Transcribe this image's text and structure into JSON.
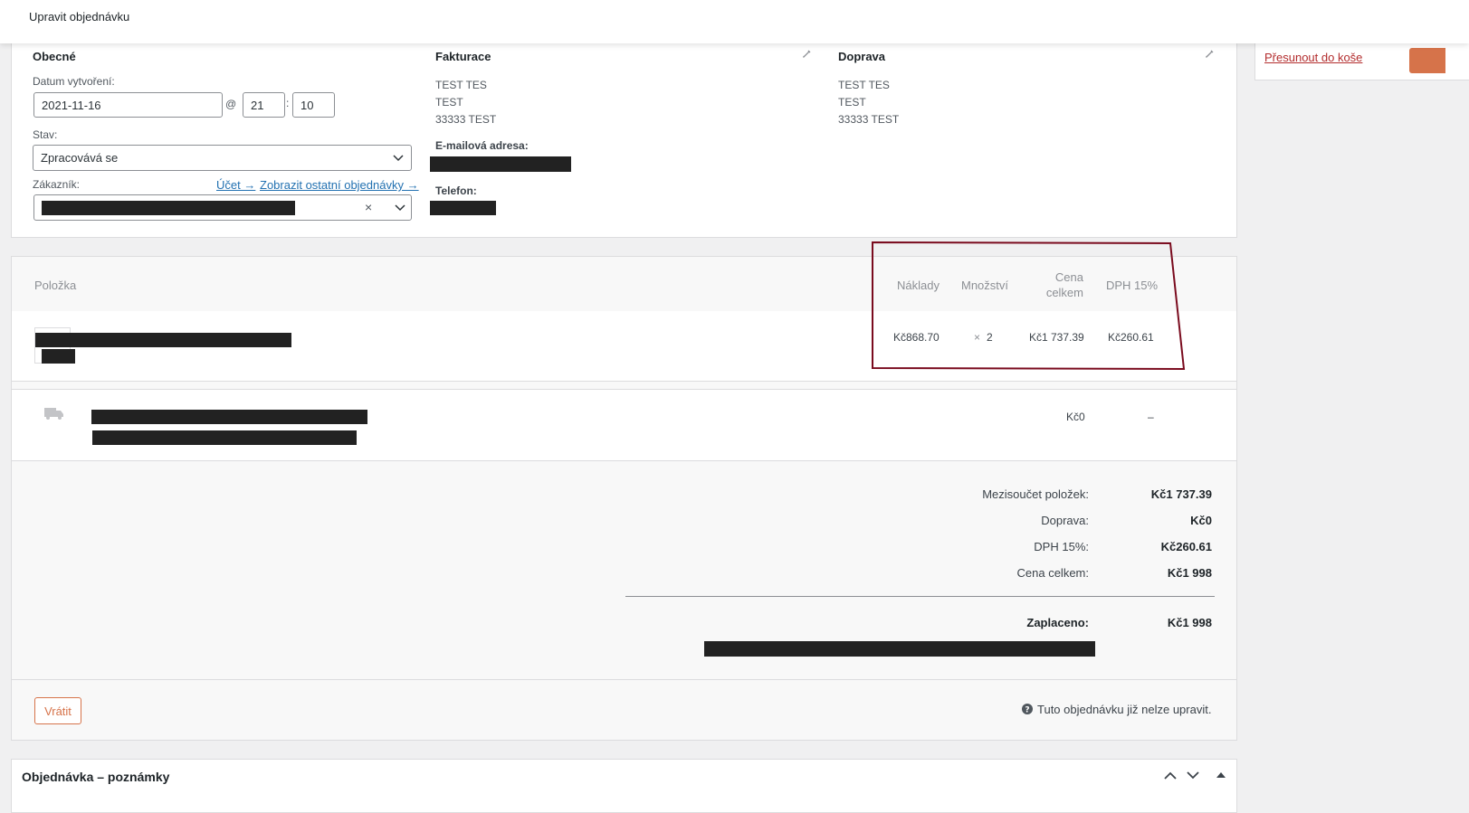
{
  "topbar": {
    "title": "Upravit objednávku"
  },
  "general": {
    "heading": "Obecné",
    "date_label": "Datum vytvoření:",
    "date_value": "2021-11-16",
    "at_sign": "@",
    "hour_value": "21",
    "colon": ":",
    "minute_value": "10",
    "status_label": "Stav:",
    "status_value": "Zpracovává se",
    "customer_label": "Zákazník:",
    "account_link": "Účet →",
    "other_orders_link": "Zobrazit ostatní objednávky →",
    "clear_symbol": "×"
  },
  "billing": {
    "heading": "Fakturace",
    "address_lines": [
      "TEST TES",
      "TEST",
      "33333 TEST"
    ],
    "email_label": "E-mailová adresa:",
    "phone_label": "Telefon:"
  },
  "shipping": {
    "heading": "Doprava",
    "address_lines": [
      "TEST TES",
      "TEST",
      "33333 TEST"
    ]
  },
  "side": {
    "trash_link": "Přesunout do koše"
  },
  "items": {
    "header_item": "Položka",
    "header_cost": "Náklady",
    "header_qty": "Množství",
    "header_total_line1": "Cena",
    "header_total_line2": "celkem",
    "header_vat": "DPH 15%",
    "row": {
      "cost": "Kč868.70",
      "qty_symbol": "×",
      "qty": "2",
      "total": "Kč1 737.39",
      "vat": "Kč260.61"
    },
    "shipping_row": {
      "total": "Kč0",
      "vat": "–"
    }
  },
  "totals": {
    "subtotal_label": "Mezisoučet položek:",
    "subtotal_value": "Kč1 737.39",
    "shipping_label": "Doprava:",
    "shipping_value": "Kč0",
    "vat_label": "DPH 15%:",
    "vat_value": "Kč260.61",
    "total_label": "Cena celkem:",
    "total_value": "Kč1 998",
    "paid_label": "Zaplaceno:",
    "paid_value": "Kč1 998"
  },
  "actions": {
    "refund_button": "Vrátit",
    "info_icon": "help-icon",
    "not_editable": "Tuto objednávku již nelze upravit."
  },
  "notes": {
    "heading": "Objednávka – poznámky"
  },
  "colors": {
    "accent": "#2271b1",
    "refund": "#d6734a",
    "highlight_box": "#7a0b1e",
    "trash": "#b32d2e"
  }
}
